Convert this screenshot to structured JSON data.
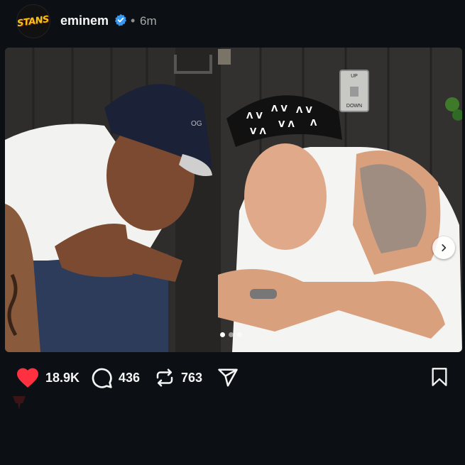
{
  "post": {
    "username": "eminem",
    "separator": "•",
    "time": "6m",
    "avatar_text": "STANS",
    "verified_color": "#3897f0"
  },
  "photo": {
    "left_cap_text": "OG",
    "elevator_up": "UP",
    "elevator_down": "DOWN",
    "carousel_total": 3,
    "carousel_active": 1
  },
  "actions": {
    "likes": "18.9K",
    "comments": "436",
    "reposts": "763",
    "like_color": "#ff3040"
  },
  "icons": [
    "verified-icon",
    "chevron-right-icon",
    "heart-icon",
    "comment-icon",
    "repost-icon",
    "share-icon",
    "bookmark-icon"
  ]
}
